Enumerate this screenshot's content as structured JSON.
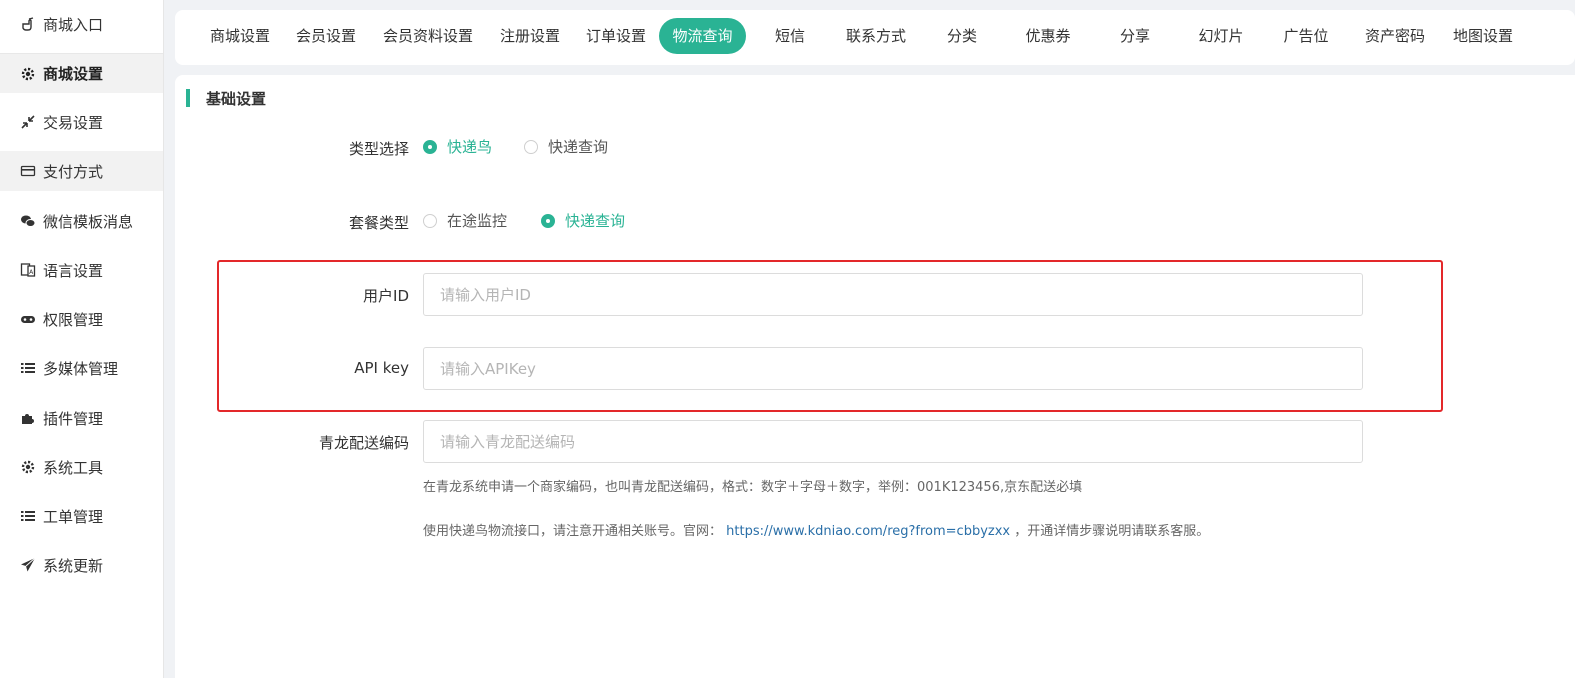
{
  "sidebar": {
    "items": [
      {
        "label": "商城入口",
        "icon": "hand-pointer-icon"
      },
      {
        "label": "商城设置",
        "icon": "gear-icon"
      },
      {
        "label": "交易设置",
        "icon": "compress-arrows-icon"
      },
      {
        "label": "支付方式",
        "icon": "credit-card-icon"
      },
      {
        "label": "微信模板消息",
        "icon": "wechat-icon"
      },
      {
        "label": "语言设置",
        "icon": "language-icon"
      },
      {
        "label": "权限管理",
        "icon": "gamepad-icon"
      },
      {
        "label": "多媒体管理",
        "icon": "list-icon"
      },
      {
        "label": "插件管理",
        "icon": "puzzle-icon"
      },
      {
        "label": "系统工具",
        "icon": "gear-icon"
      },
      {
        "label": "工单管理",
        "icon": "list-icon"
      },
      {
        "label": "系统更新",
        "icon": "paper-plane-icon"
      }
    ]
  },
  "tabs": [
    {
      "label": "商城设置"
    },
    {
      "label": "会员设置"
    },
    {
      "label": "会员资料设置"
    },
    {
      "label": "注册设置"
    },
    {
      "label": "订单设置"
    },
    {
      "label": "物流查询"
    },
    {
      "label": "短信"
    },
    {
      "label": "联系方式"
    },
    {
      "label": "分类"
    },
    {
      "label": "优惠券"
    },
    {
      "label": "分享"
    },
    {
      "label": "幻灯片"
    },
    {
      "label": "广告位"
    },
    {
      "label": "资产密码"
    },
    {
      "label": "地图设置"
    }
  ],
  "active_tab": "物流查询",
  "section": {
    "title": "基础设置"
  },
  "form": {
    "type_select": {
      "label": "类型选择",
      "options": [
        {
          "label": "快递鸟",
          "checked": true
        },
        {
          "label": "快递查询",
          "checked": false
        }
      ]
    },
    "package_type": {
      "label": "套餐类型",
      "options": [
        {
          "label": "在途监控",
          "checked": false
        },
        {
          "label": "快递查询",
          "checked": true
        }
      ]
    },
    "user_id": {
      "label": "用户ID",
      "value": "",
      "placeholder": "请输入用户ID"
    },
    "api_key": {
      "label": "API key",
      "value": "",
      "placeholder": "请输入APIKey"
    },
    "qinglong_code": {
      "label": "青龙配送编码",
      "value": "",
      "placeholder": "请输入青龙配送编码"
    },
    "help1": "在青龙系统申请一个商家编码，也叫青龙配送编码，格式：数字＋字母＋数字，举例：001K123456,京东配送必填",
    "help2_prefix": "使用快递鸟物流接口，请注意开通相关账号。官网：",
    "help2_link": "https://www.kdniao.com/reg?from=cbbyzxx",
    "help2_suffix": "，开通详情步骤说明请联系客服。"
  },
  "colors": {
    "accent": "#2ab394",
    "highlight_border": "#e3282a",
    "link": "#2a6fa8"
  }
}
